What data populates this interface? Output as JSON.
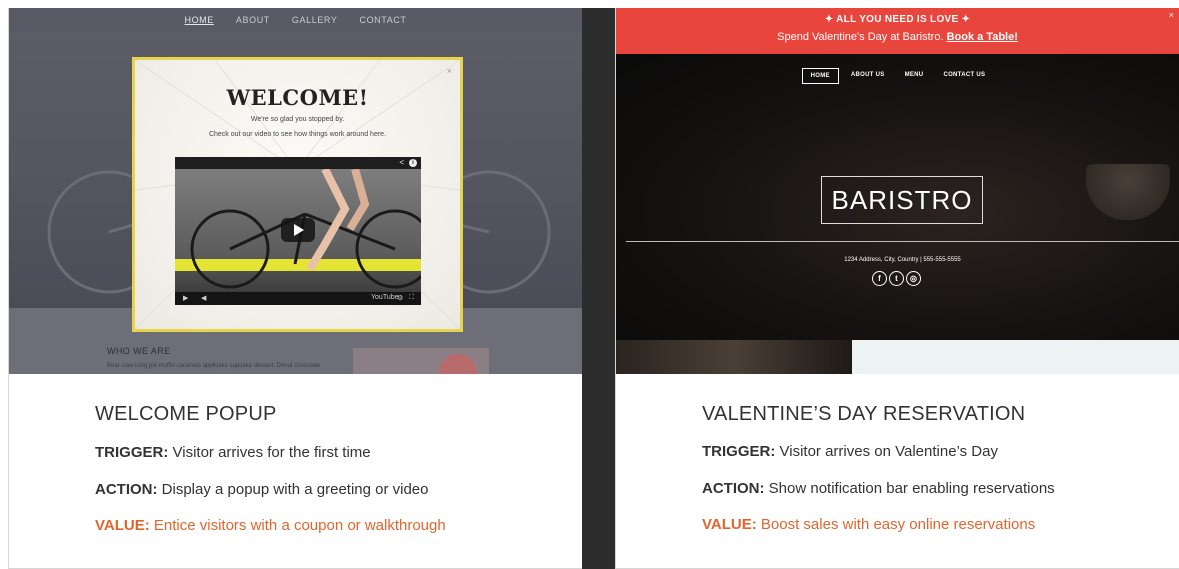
{
  "left_panel": {
    "site_nav": [
      "HOME",
      "ABOUT",
      "GALLERY",
      "CONTACT"
    ],
    "popup": {
      "close": "×",
      "title": "WELCOME!",
      "line1": "We're so glad you stopped by.",
      "line2": "Check out our video to see how things work around here.",
      "video_logo": "YouTube"
    },
    "section_title": "WHO WE ARE",
    "section_text": "Bear claw icing pie muffin caramels applicake cupcake dessert. Donut chocolate",
    "caption": {
      "title": "WELCOME POPUP",
      "trigger_label": "TRIGGER:",
      "trigger_text": " Visitor arrives for the first time",
      "action_label": "ACTION:",
      "action_text": " Display a popup with a greeting or video",
      "value_label": "VALUE:",
      "value_text": " Entice visitors with a coupon or walkthrough"
    }
  },
  "right_panel": {
    "promo": {
      "line1": "✦ ALL YOU NEED IS LOVE ✦",
      "line2": "Spend Valentine's Day at Baristro. ",
      "link": "Book a Table!",
      "close": "×"
    },
    "site_nav": [
      "HOME",
      "ABOUT US",
      "MENU",
      "CONTACT US"
    ],
    "logo": "BARISTRO",
    "address": "1234 Address, City, Country | 555-555-5555",
    "social_icons": [
      "facebook-icon",
      "twitter-icon",
      "instagram-icon"
    ],
    "caption": {
      "title": "VALENTINE’S DAY RESERVATION",
      "trigger_label": "TRIGGER:",
      "trigger_text": " Visitor arrives on Valentine’s Day",
      "action_label": "ACTION:",
      "action_text": " Show notification bar enabling reservations",
      "value_label": "VALUE:",
      "value_text": " Boost sales with easy online reservations"
    }
  },
  "colors": {
    "accent_orange": "#e0662e",
    "promo_red": "#e8453c",
    "popup_border": "#e8d44a",
    "divider": "#2c2c2c"
  }
}
